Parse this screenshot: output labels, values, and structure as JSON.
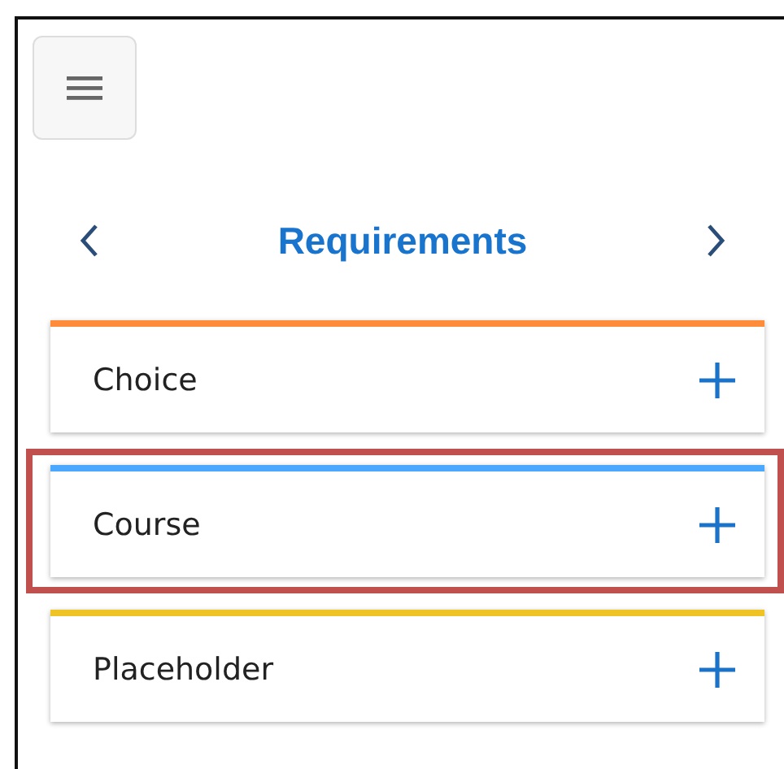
{
  "header": {
    "title": "Requirements"
  },
  "items": [
    {
      "label": "Choice",
      "color": "#ff8c3a",
      "highlighted": false
    },
    {
      "label": "Course",
      "color": "#4aa8ff",
      "highlighted": true
    },
    {
      "label": "Placeholder",
      "color": "#f0c324",
      "highlighted": false
    }
  ]
}
